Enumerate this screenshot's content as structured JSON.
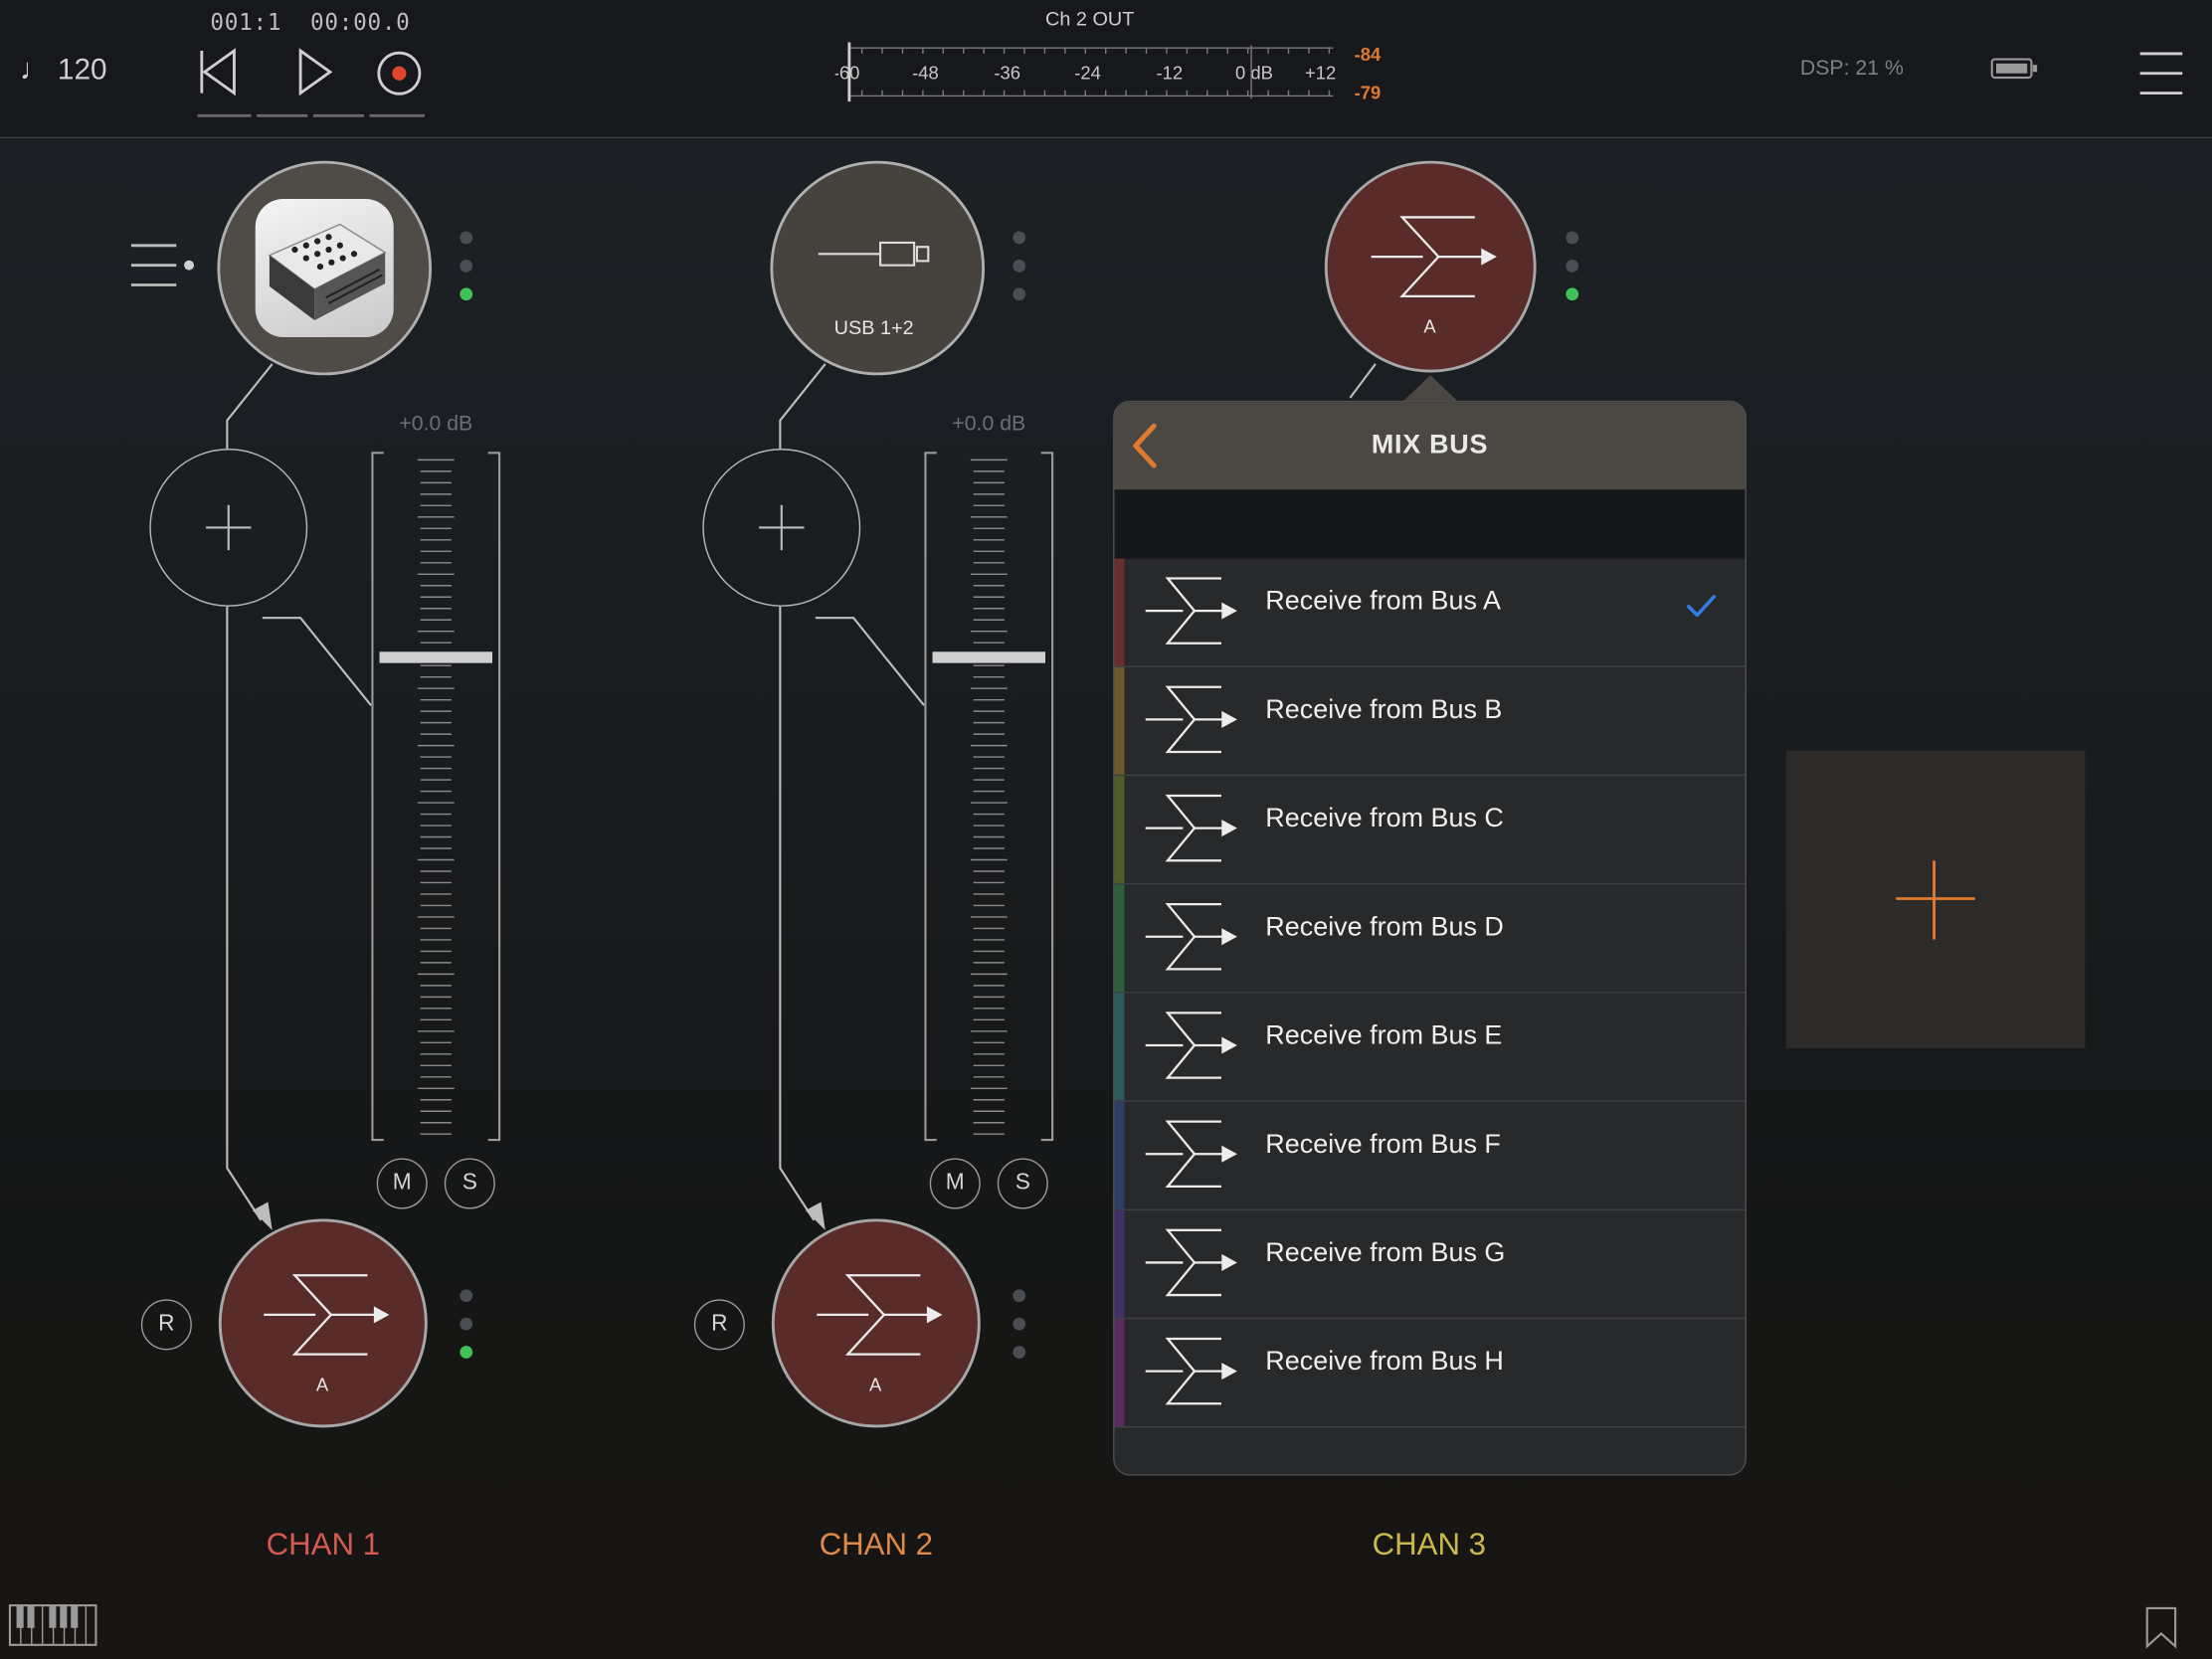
{
  "transport": {
    "tempo_icon": "quarter-note",
    "tempo": "120",
    "counter_bars": "001:1",
    "counter_time": "00:00.0",
    "buttons": [
      "rewind-icon",
      "play-icon",
      "record-icon"
    ]
  },
  "meter": {
    "title": "Ch 2 OUT",
    "scale": [
      "-60",
      "-48",
      "-36",
      "-24",
      "-12",
      "0 dB",
      "+12"
    ],
    "peak_left": "-84",
    "peak_right": "-79"
  },
  "dsp": "DSP: 21 %",
  "icons": {
    "battery": "battery-icon",
    "menu": "hamburger-menu-icon",
    "keyboard": "piano-keyboard-icon",
    "bookmark": "bookmark-icon",
    "channel_list": "channel-list-icon"
  },
  "channels": [
    {
      "name": "CHAN 1",
      "color": "#d45a52",
      "input": "synth-instrument",
      "fader_db": "+0.0 dB",
      "mute": "M",
      "solo": "S",
      "record": "R",
      "output_bus": "A"
    },
    {
      "name": "CHAN 2",
      "color": "#e0894a",
      "input": "USB 1+2",
      "fader_db": "+0.0 dB",
      "mute": "M",
      "solo": "S",
      "record": "R",
      "output_bus": "A"
    },
    {
      "name": "CHAN 3",
      "color": "#c9b84a",
      "input": "A"
    }
  ],
  "mixbus_popover": {
    "title": "MIX BUS",
    "back_icon": "chevron-left-icon",
    "items": [
      {
        "label": "Receive from Bus A",
        "color": "#6a2f2c",
        "selected": true
      },
      {
        "label": "Receive from Bus B",
        "color": "#6a5a2c",
        "selected": false
      },
      {
        "label": "Receive from Bus C",
        "color": "#4f5e2c",
        "selected": false
      },
      {
        "label": "Receive from Bus D",
        "color": "#2f5e3a",
        "selected": false
      },
      {
        "label": "Receive from Bus E",
        "color": "#2c5a5e",
        "selected": false
      },
      {
        "label": "Receive from Bus F",
        "color": "#2c3f66",
        "selected": false
      },
      {
        "label": "Receive from Bus G",
        "color": "#43306a",
        "selected": false
      },
      {
        "label": "Receive from Bus H",
        "color": "#5a2c5e",
        "selected": false
      }
    ]
  },
  "accent": "#e07a2e",
  "check_color": "#2f7fe6"
}
